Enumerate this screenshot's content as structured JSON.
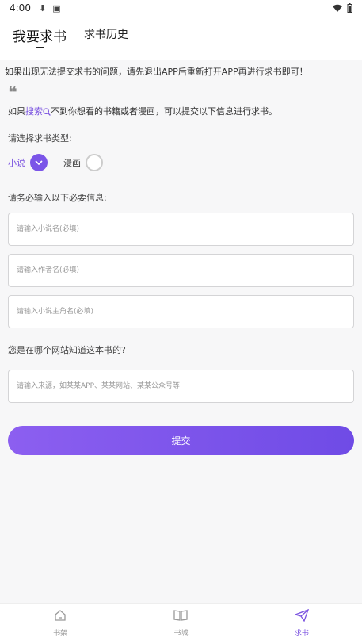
{
  "status": {
    "time": "4:00"
  },
  "header": {
    "tabs": [
      {
        "label": "我要求书",
        "active": true
      },
      {
        "label": "求书历史",
        "active": false
      }
    ]
  },
  "notice": "如果出现无法提交求书的问题，请先退出APP后重新打开APP再进行求书即可！",
  "quote_mark": "❝",
  "hint": {
    "pre": "如果",
    "link": "搜索",
    "post": "不到你想看的书籍或者漫画，可以提交以下信息进行求书。"
  },
  "type_section": {
    "label": "请选择求书类型:",
    "options": [
      {
        "label": "小说",
        "selected": true
      },
      {
        "label": "漫画",
        "selected": false
      }
    ]
  },
  "info_section": {
    "label": "请务必输入以下必要信息:"
  },
  "fields": {
    "title_placeholder": "请输入小说名(必填)",
    "author_placeholder": "请输入作者名(必填)",
    "protagonist_placeholder": "请输入小说主角名(必填)"
  },
  "source_section": {
    "label": "您是在哪个网站知道这本书的?",
    "placeholder": "请输入来源，如某某APP、某某网站、某某公众号等"
  },
  "submit_label": "提交",
  "bottom_nav": [
    {
      "label": "书架",
      "icon": "home-icon",
      "active": false
    },
    {
      "label": "书城",
      "icon": "book-icon",
      "active": false
    },
    {
      "label": "求书",
      "icon": "send-icon",
      "active": true
    }
  ],
  "colors": {
    "accent": "#7b55e8",
    "background": "#f7f7f8"
  }
}
